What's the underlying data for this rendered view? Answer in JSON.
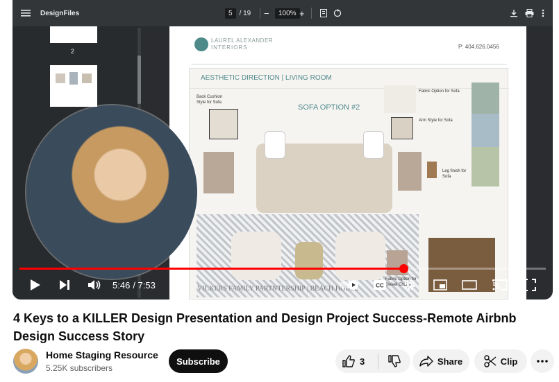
{
  "pdf_viewer": {
    "app_name": "DesignFiles",
    "page_current": "5",
    "page_total": "/ 19",
    "zoom": "100%",
    "thumb_page_label": "2"
  },
  "document": {
    "brand_line1": "LAUREL ALEXANDER",
    "brand_line2": "INTERIORS",
    "phone": "P: 404.626.0456",
    "section_title": "AESTHETIC DIRECTION | LIVING ROOM",
    "sofa_option": "SOFA OPTION #2",
    "label_back_cushion": "Back Cushion Style for Sofa",
    "label_fabric_sofa": "Fabric Option for Sofa",
    "label_arm_style": "Arm Style for Sofa",
    "label_leg_finish": "Leg finish for Sofa",
    "label_fabric_chairs": "Fabric Option for Swivel Chairs",
    "footer": "VICKERS FAMILY PARTNTERSHIP | BEACH HOUSE"
  },
  "player": {
    "current_time": "5:46",
    "duration": "/ 7:53",
    "progress_fraction": 0.73,
    "accent_color": "#ff0000"
  },
  "video": {
    "title": "4 Keys to a KILLER Design Presentation and Design Project Success-Remote Airbnb Design Success Story"
  },
  "channel": {
    "name": "Home Staging Resource",
    "subscribers": "5.25K subscribers",
    "subscribe_label": "Subscribe"
  },
  "actions": {
    "like_count": "3",
    "share_label": "Share",
    "clip_label": "Clip"
  }
}
